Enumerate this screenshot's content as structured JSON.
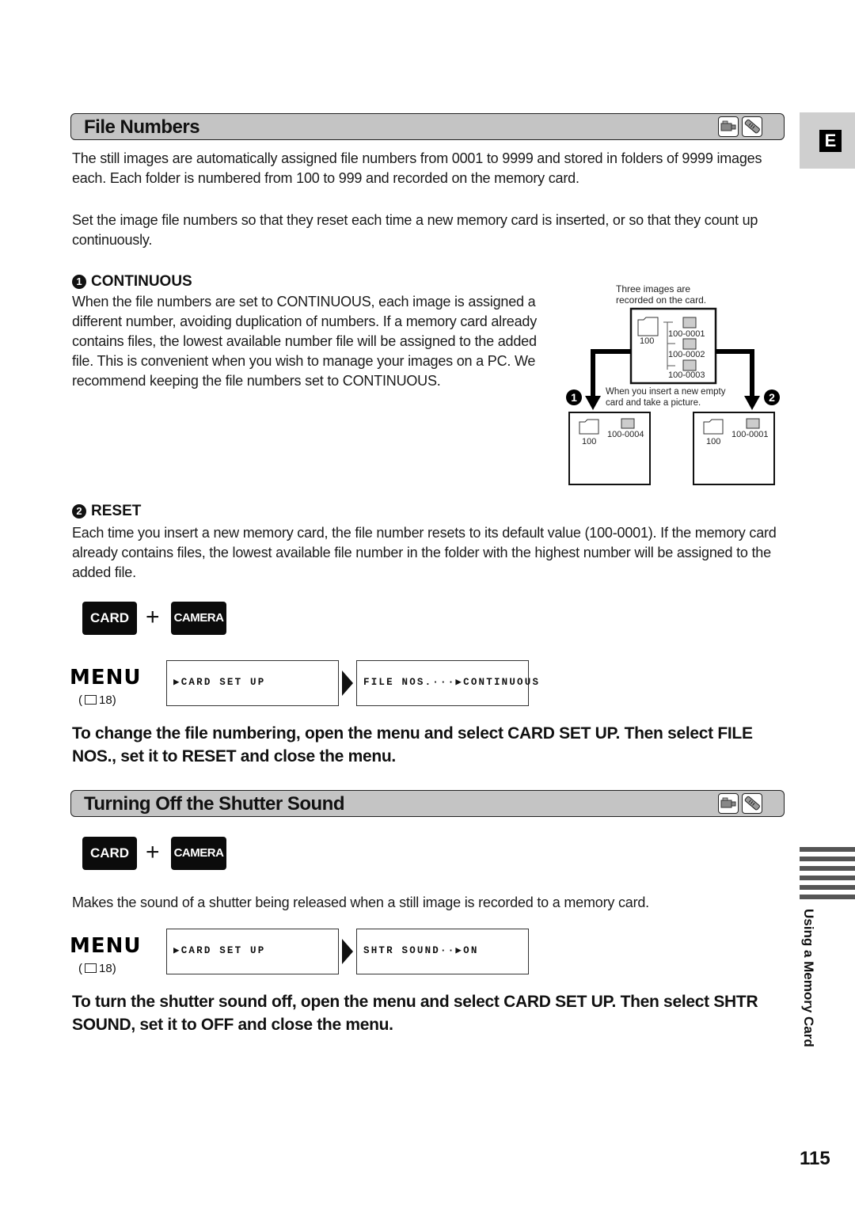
{
  "side_tab": {
    "letter": "E",
    "section_label": "Using a Memory Card"
  },
  "page_number": "115",
  "section1": {
    "title": "File Numbers",
    "icons": [
      "camcorder-icon",
      "remote-control-icon"
    ],
    "intro": "The still images are automatically assigned file numbers from 0001 to 9999 and stored in folders of 9999 images each. Each folder is numbered from 100 to 999 and recorded on the memory card.",
    "intro2": "Set the image file numbers so that they reset each time a new memory card is inserted, or so that they count up continuously.",
    "continuous": {
      "number": "1",
      "heading": "CONTINUOUS",
      "body": "When the file numbers are set to CONTINUOUS, each image is assigned a different number, avoiding duplication of numbers. If a memory card already contains files, the lowest available number file will be assigned to the added file. This is convenient when you wish to manage your images on a PC. We recommend keeping the file numbers set to CONTINUOUS."
    },
    "reset": {
      "number": "2",
      "heading": "RESET",
      "body": "Each time you insert a new memory card, the file number resets to its default value (100-0001). If the memory card already contains files, the lowest available file number in the folder with the highest number will be assigned to the added file."
    },
    "diagram": {
      "caption_top_1": "Three images are",
      "caption_top_2": "recorded on the card.",
      "folder": "100",
      "files": [
        "100-0001",
        "100-0002",
        "100-0003"
      ],
      "caption_mid_1": "When you insert a new empty",
      "caption_mid_2": "card and take a picture.",
      "left_marker": "1",
      "right_marker": "2",
      "left_result": {
        "folder": "100",
        "file": "100-0004"
      },
      "right_result": {
        "folder": "100",
        "file": "100-0001"
      }
    },
    "mode_keys": {
      "key1": "CARD",
      "plus": "+",
      "key2": "CAMERA"
    },
    "menu": {
      "label": "MENU",
      "ref": "( 🕮 18)",
      "ref_text": "18",
      "step1": "▶CARD SET UP",
      "step2": "FILE NOS.···▶CONTINUOUS"
    },
    "instruction": "To change the file numbering, open the menu and select CARD SET UP. Then select FILE NOS., set it to RESET and close the menu."
  },
  "section2": {
    "title": "Turning Off the Shutter Sound",
    "icons": [
      "camcorder-icon",
      "remote-control-icon"
    ],
    "mode_keys": {
      "key1": "CARD",
      "plus": "+",
      "key2": "CAMERA"
    },
    "description": "Makes the sound of a shutter being released when a still image is recorded to a memory card.",
    "menu": {
      "label": "MENU",
      "ref_text": "18",
      "step1": "▶CARD SET UP",
      "step2": "SHTR SOUND··▶ON"
    },
    "instruction": "To turn the shutter sound off, open the menu and select CARD SET UP. Then select SHTR SOUND, set it to OFF and close the menu."
  }
}
